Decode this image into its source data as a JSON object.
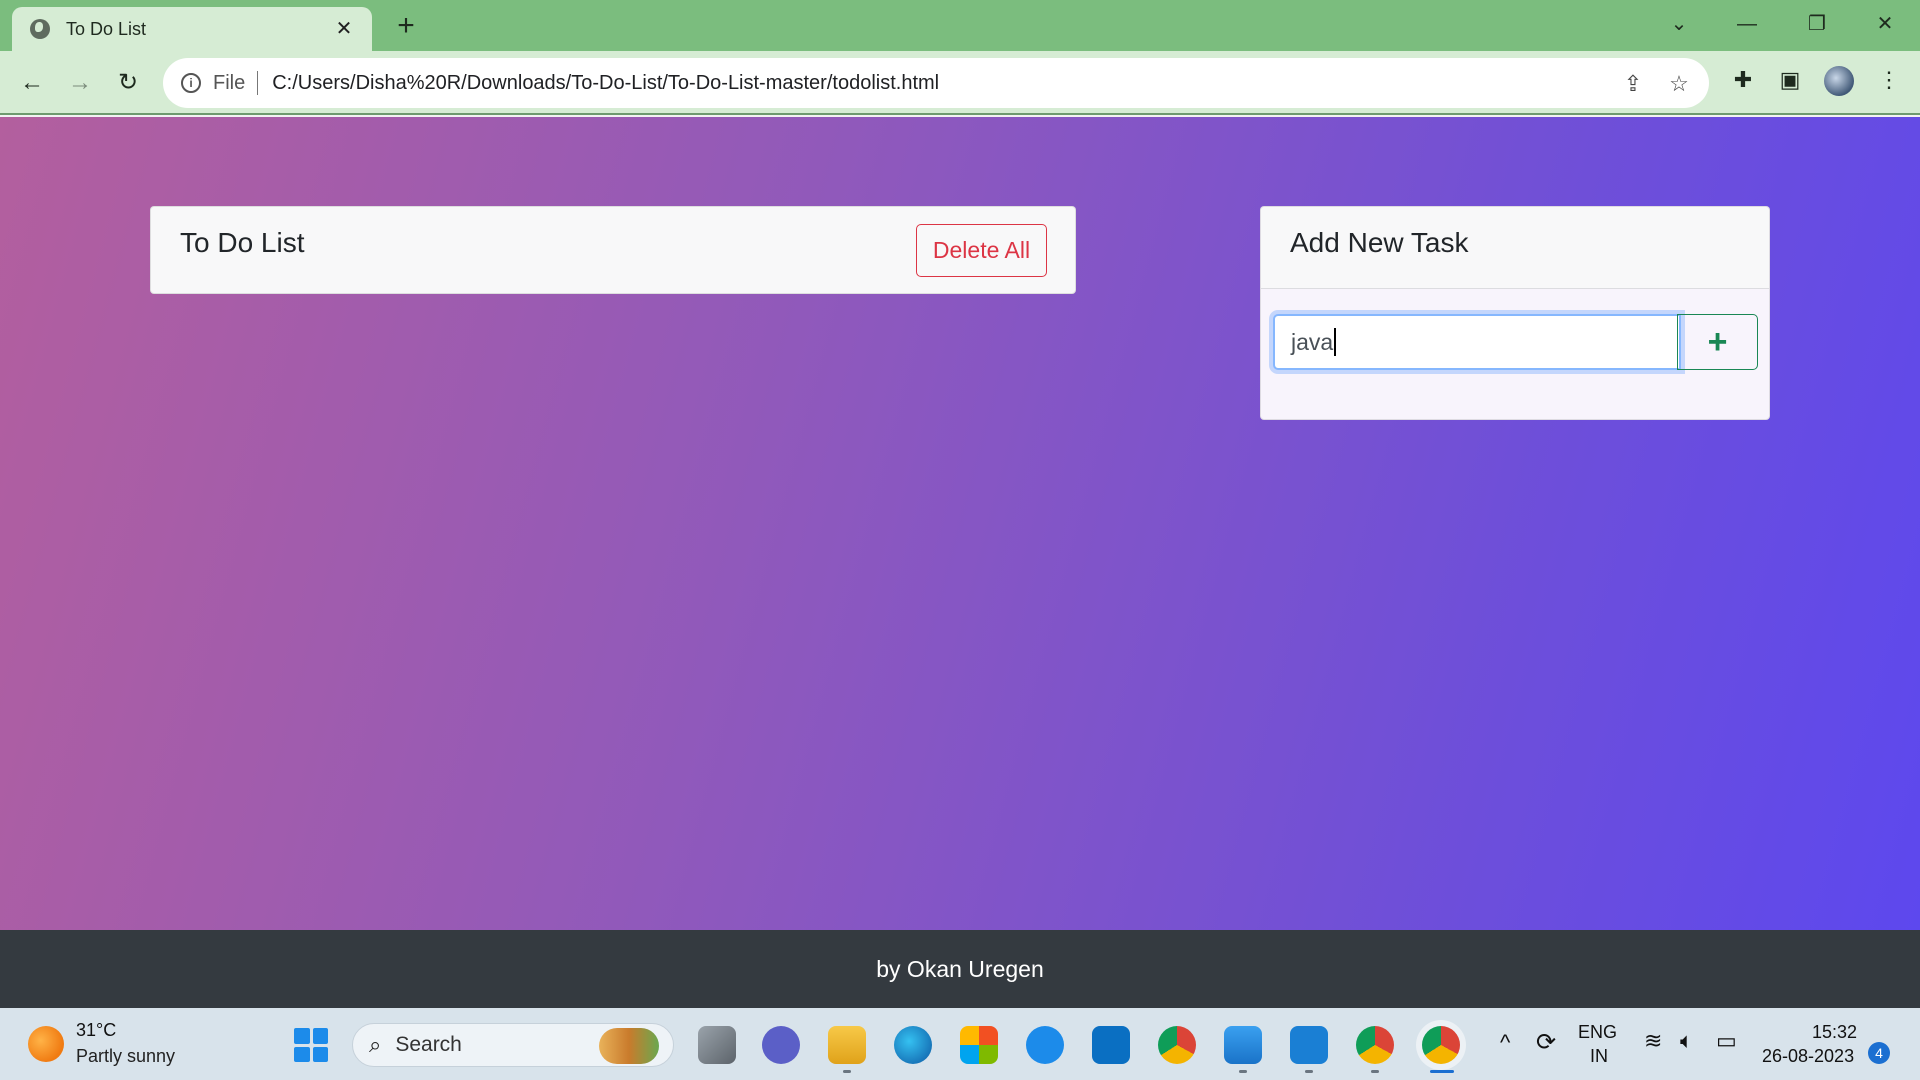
{
  "browser": {
    "tab_title": "To Do List",
    "tab_close": "✕",
    "new_tab": "+",
    "address": {
      "scheme_label": "File",
      "url": "C:/Users/Disha%20R/Downloads/To-Do-List/To-Do-List-master/todolist.html"
    }
  },
  "page": {
    "list_card": {
      "title": "To Do List",
      "delete_all_label": "Delete All"
    },
    "add_card": {
      "title": "Add New Task",
      "input_value": "java",
      "add_label": "+"
    },
    "footer": "by Okan Uregen"
  },
  "taskbar": {
    "weather_temp": "31°C",
    "weather_desc": "Partly sunny",
    "search_label": "Search",
    "language": "ENG",
    "region": "IN",
    "time": "15:32",
    "date": "26-08-2023",
    "notification_count": "4"
  },
  "colors": {
    "danger": "#dc3545",
    "success": "#198754",
    "footer_bg": "#343a40"
  }
}
